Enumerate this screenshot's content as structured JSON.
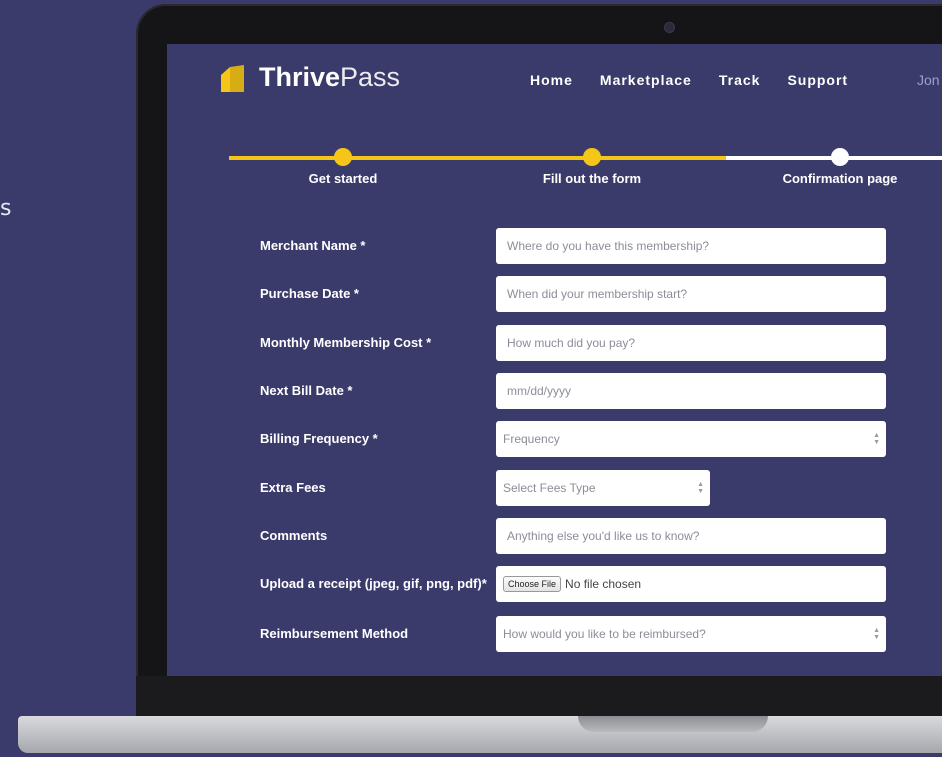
{
  "edge_text": "s",
  "brand": {
    "bold": "Thrive",
    "light": "Pass",
    "accent": "#f5c518"
  },
  "nav": {
    "items": [
      "Home",
      "Marketplace",
      "Track",
      "Support"
    ],
    "user": "Jon"
  },
  "steps": [
    {
      "label": "Get started",
      "state": "done"
    },
    {
      "label": "Fill out the form",
      "state": "done"
    },
    {
      "label": "Confirmation page",
      "state": "todo"
    }
  ],
  "form": {
    "merchant": {
      "label": "Merchant Name *",
      "placeholder": "Where do you have this membership?"
    },
    "purchase_date": {
      "label": "Purchase Date *",
      "placeholder": "When did your membership start?"
    },
    "monthly_cost": {
      "label": "Monthly Membership Cost *",
      "placeholder": "How much did you pay?"
    },
    "next_bill": {
      "label": "Next Bill Date *",
      "placeholder": "mm/dd/yyyy"
    },
    "billing_frequency": {
      "label": "Billing Frequency *",
      "value": "Frequency"
    },
    "extra_fees": {
      "label": "Extra Fees",
      "value": "Select Fees Type"
    },
    "comments": {
      "label": "Comments",
      "placeholder": "Anything else you'd like us to know?"
    },
    "receipt": {
      "label": "Upload a receipt (jpeg, gif, png, pdf)*",
      "button": "Choose File",
      "status": "No file chosen"
    },
    "reimbursement": {
      "label": "Reimbursement Method",
      "value": "How would you like to be reimbursed?"
    }
  }
}
